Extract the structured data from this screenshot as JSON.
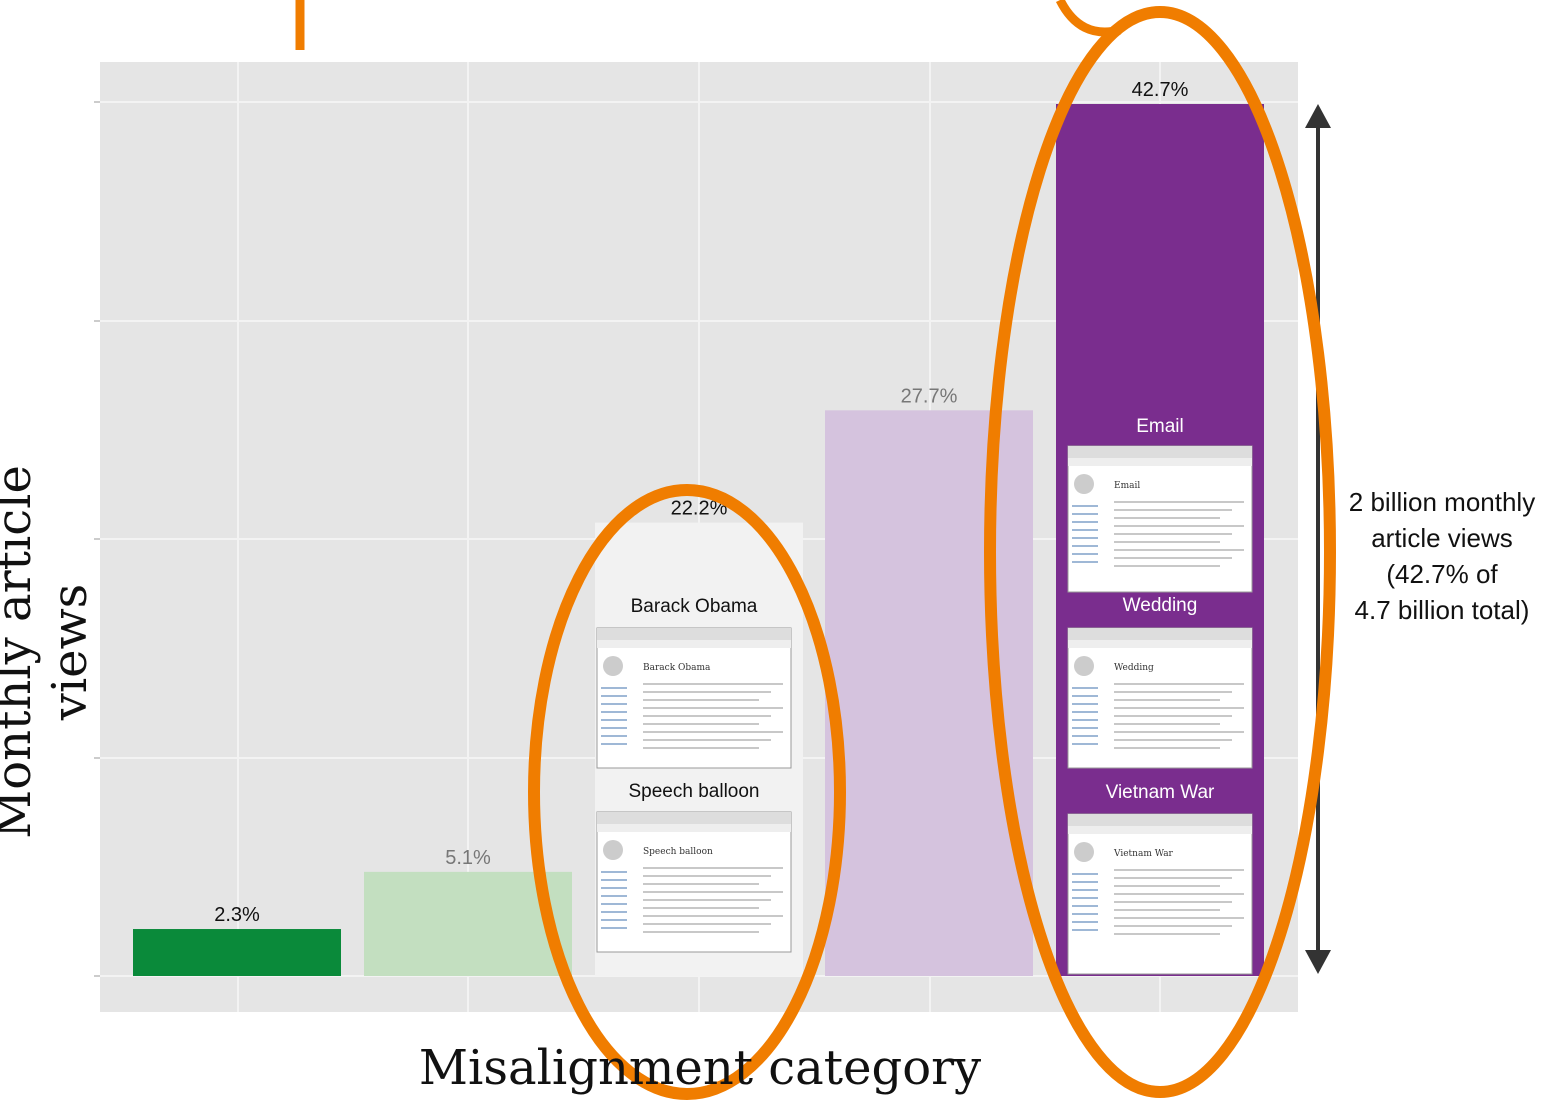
{
  "chart_data": {
    "type": "bar",
    "title": "",
    "xlabel": "Misalignment category",
    "ylabel": "Monthly article views",
    "categories": [
      "",
      "",
      "",
      "",
      ""
    ],
    "values": [
      2.3,
      5.1,
      22.2,
      27.7,
      42.7
    ],
    "value_labels": [
      "2.3%",
      "5.1%",
      "22.2%",
      "27.7%",
      "42.7%"
    ],
    "colors": [
      "#0a8a3a",
      "#c3dfc0",
      "#f2f2f2",
      "#d5c3de",
      "#7a2d8e"
    ],
    "label_colors": [
      "#111111",
      "#777777",
      "#111111",
      "#777777",
      "#111111"
    ],
    "ylim": [
      0,
      44.5
    ],
    "grid": true,
    "grid_color": "#e5e5e5",
    "thumbnails": [
      {
        "bar": 2,
        "label": "Barack Obama",
        "article_title": "Barack Obama"
      },
      {
        "bar": 2,
        "label": "Speech balloon",
        "article_title": "Speech balloon"
      },
      {
        "bar": 4,
        "label": "Email",
        "article_title": "Email"
      },
      {
        "bar": 4,
        "label": "Wedding",
        "article_title": "Wedding"
      },
      {
        "bar": 4,
        "label": "Vietnam War",
        "article_title": "Vietnam War"
      }
    ],
    "highlight_color": "#f07d00",
    "annotation": {
      "lines": [
        "2 billion monthly",
        "article views",
        "(42.7% of",
        "4.7 billion total)"
      ]
    }
  }
}
